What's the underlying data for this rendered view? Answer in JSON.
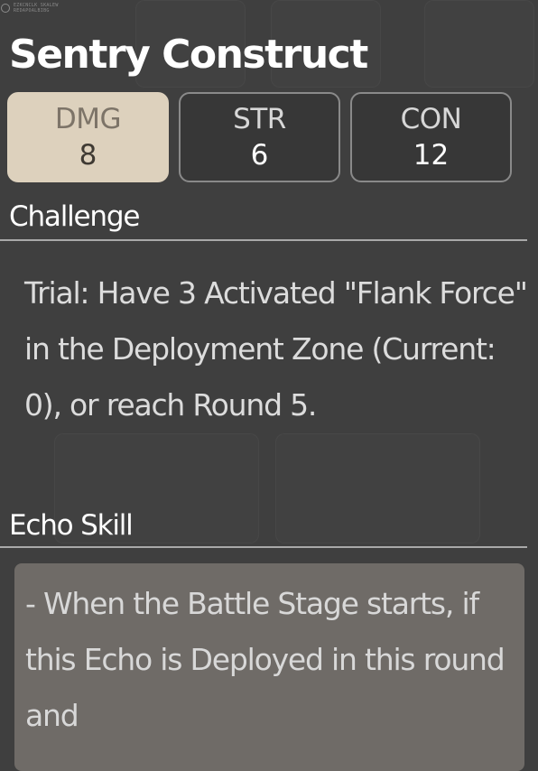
{
  "top_marker": {
    "line1": "EZKCNCLK SKALEW",
    "line2": "REDAPOALBIBG"
  },
  "card": {
    "title": "Sentry Construct",
    "stats": [
      {
        "label": "DMG",
        "value": "8"
      },
      {
        "label": "STR",
        "value": "6"
      },
      {
        "label": "CON",
        "value": "12"
      }
    ],
    "challenge": {
      "heading": "Challenge",
      "text": "Trial: Have 3 Activated \"Flank Force\" in the Deployment Zone (Current: 0), or reach Round 5."
    },
    "echo_skill": {
      "heading": "Echo Skill",
      "text": "- When the Battle Stage starts, if this Echo is Deployed in this round and"
    }
  },
  "colors": {
    "background": "#3f3f3f",
    "active_stat": "#ddd1bd",
    "stat_border": "#8a8a8a",
    "divider": "#a9a9a9",
    "echo_box": "#6f6b67"
  }
}
